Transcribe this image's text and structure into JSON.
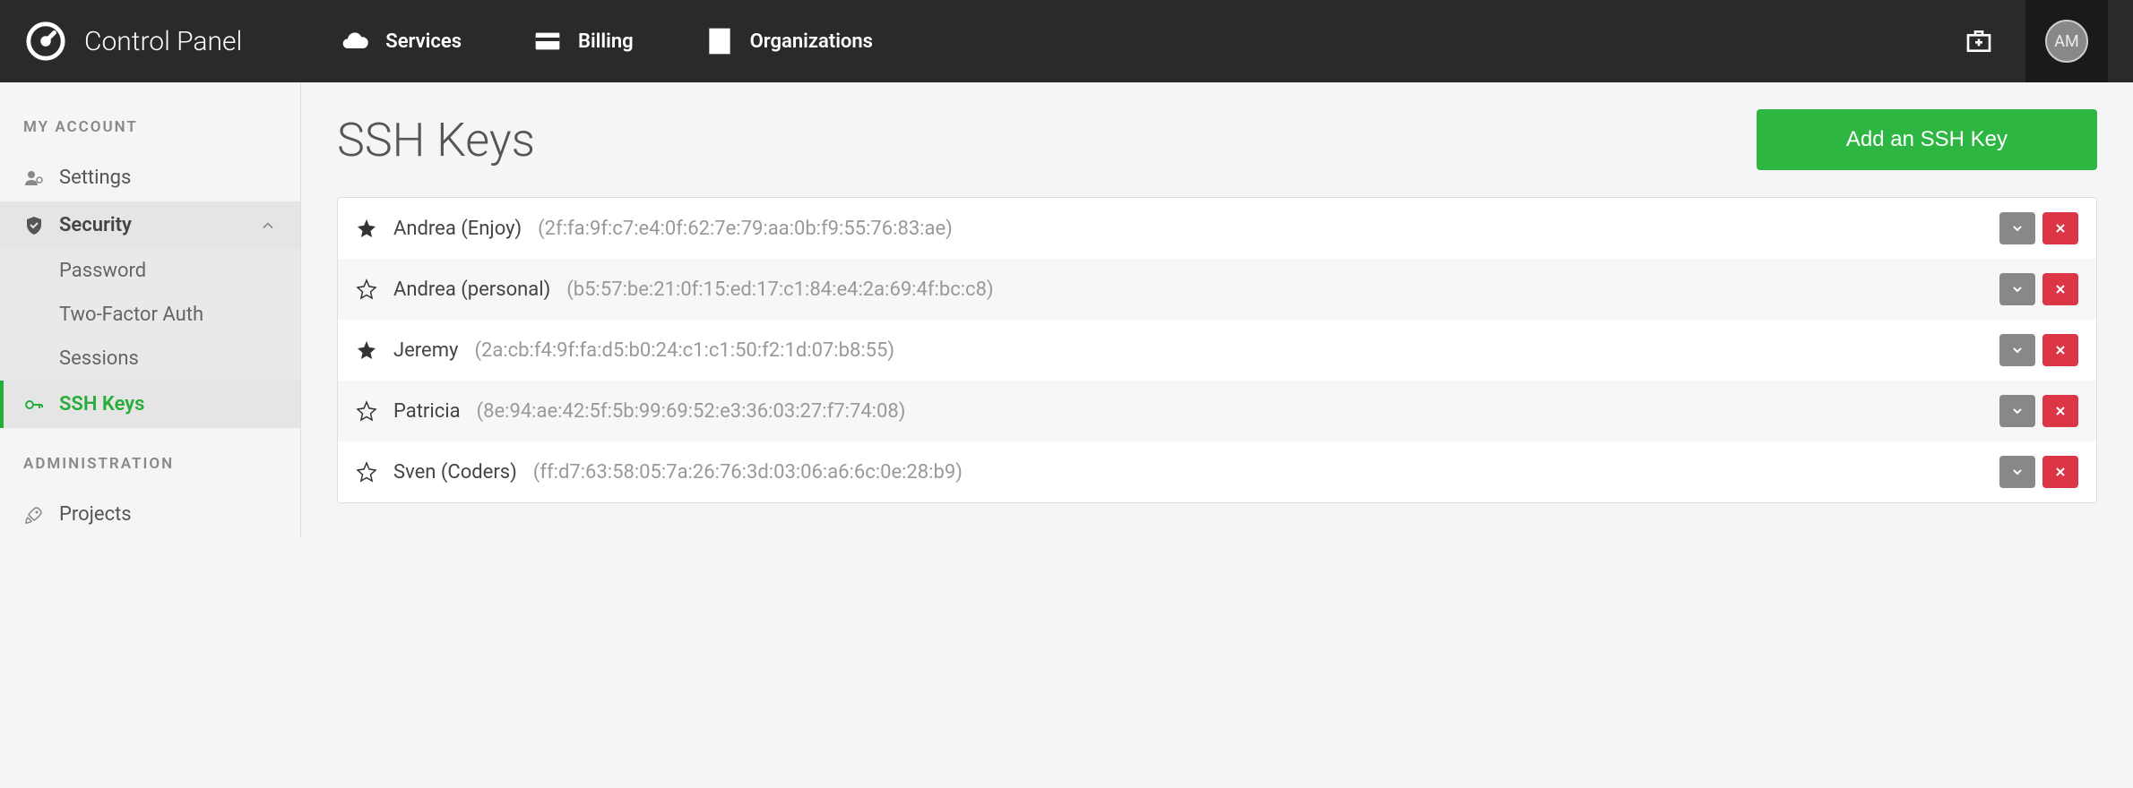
{
  "header": {
    "title": "Control Panel",
    "nav": [
      {
        "label": "Services",
        "icon": "cloud-icon"
      },
      {
        "label": "Billing",
        "icon": "card-icon"
      },
      {
        "label": "Organizations",
        "icon": "building-icon"
      }
    ],
    "avatar_initials": "AM"
  },
  "sidebar": {
    "sections": [
      {
        "title": "MY ACCOUNT",
        "items": [
          {
            "label": "Settings",
            "icon": "user-gear-icon"
          },
          {
            "label": "Security",
            "icon": "shield-icon",
            "active": true,
            "children": [
              {
                "label": "Password"
              },
              {
                "label": "Two-Factor Auth"
              },
              {
                "label": "Sessions"
              },
              {
                "label": "SSH Keys",
                "selected": true,
                "icon": "key-icon"
              }
            ]
          }
        ]
      },
      {
        "title": "ADMINISTRATION",
        "items": [
          {
            "label": "Projects",
            "icon": "rocket-icon"
          }
        ]
      }
    ]
  },
  "main": {
    "title": "SSH Keys",
    "add_button_label": "Add an SSH Key",
    "keys": [
      {
        "starred": true,
        "name": "Andrea (Enjoy)",
        "fingerprint": "(2f:fa:9f:c7:e4:0f:62:7e:79:aa:0b:f9:55:76:83:ae)"
      },
      {
        "starred": false,
        "name": "Andrea (personal)",
        "fingerprint": "(b5:57:be:21:0f:15:ed:17:c1:84:e4:2a:69:4f:bc:c8)"
      },
      {
        "starred": true,
        "name": "Jeremy",
        "fingerprint": "(2a:cb:f4:9f:fa:d5:b0:24:c1:c1:50:f2:1d:07:b8:55)"
      },
      {
        "starred": false,
        "name": "Patricia",
        "fingerprint": "(8e:94:ae:42:5f:5b:99:69:52:e3:36:03:27:f7:74:08)"
      },
      {
        "starred": false,
        "name": "Sven (Coders)",
        "fingerprint": "(ff:d7:63:58:05:7a:26:76:3d:03:06:a6:6c:0e:28:b9)"
      }
    ]
  }
}
